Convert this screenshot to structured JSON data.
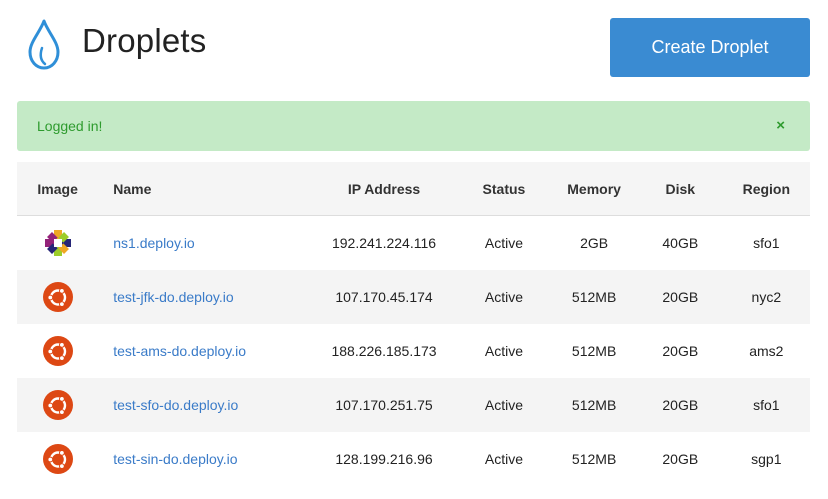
{
  "header": {
    "title": "Droplets",
    "create_label": "Create Droplet",
    "accent": "#3a8bd2"
  },
  "alert": {
    "message": "Logged in!",
    "close": "×",
    "color": "#c4eac6"
  },
  "table": {
    "columns": [
      "Image",
      "Name",
      "IP Address",
      "Status",
      "Memory",
      "Disk",
      "Region"
    ],
    "rows": [
      {
        "image": "centos-icon",
        "name": "ns1.deploy.io",
        "ip": "192.241.224.116",
        "status": "Active",
        "memory": "2GB",
        "disk": "40GB",
        "region": "sfo1"
      },
      {
        "image": "ubuntu-icon",
        "name": "test-jfk-do.deploy.io",
        "ip": "107.170.45.174",
        "status": "Active",
        "memory": "512MB",
        "disk": "20GB",
        "region": "nyc2"
      },
      {
        "image": "ubuntu-icon",
        "name": "test-ams-do.deploy.io",
        "ip": "188.226.185.173",
        "status": "Active",
        "memory": "512MB",
        "disk": "20GB",
        "region": "ams2"
      },
      {
        "image": "ubuntu-icon",
        "name": "test-sfo-do.deploy.io",
        "ip": "107.170.251.75",
        "status": "Active",
        "memory": "512MB",
        "disk": "20GB",
        "region": "sfo1"
      },
      {
        "image": "ubuntu-icon",
        "name": "test-sin-do.deploy.io",
        "ip": "128.199.216.96",
        "status": "Active",
        "memory": "512MB",
        "disk": "20GB",
        "region": "sgp1"
      }
    ]
  }
}
